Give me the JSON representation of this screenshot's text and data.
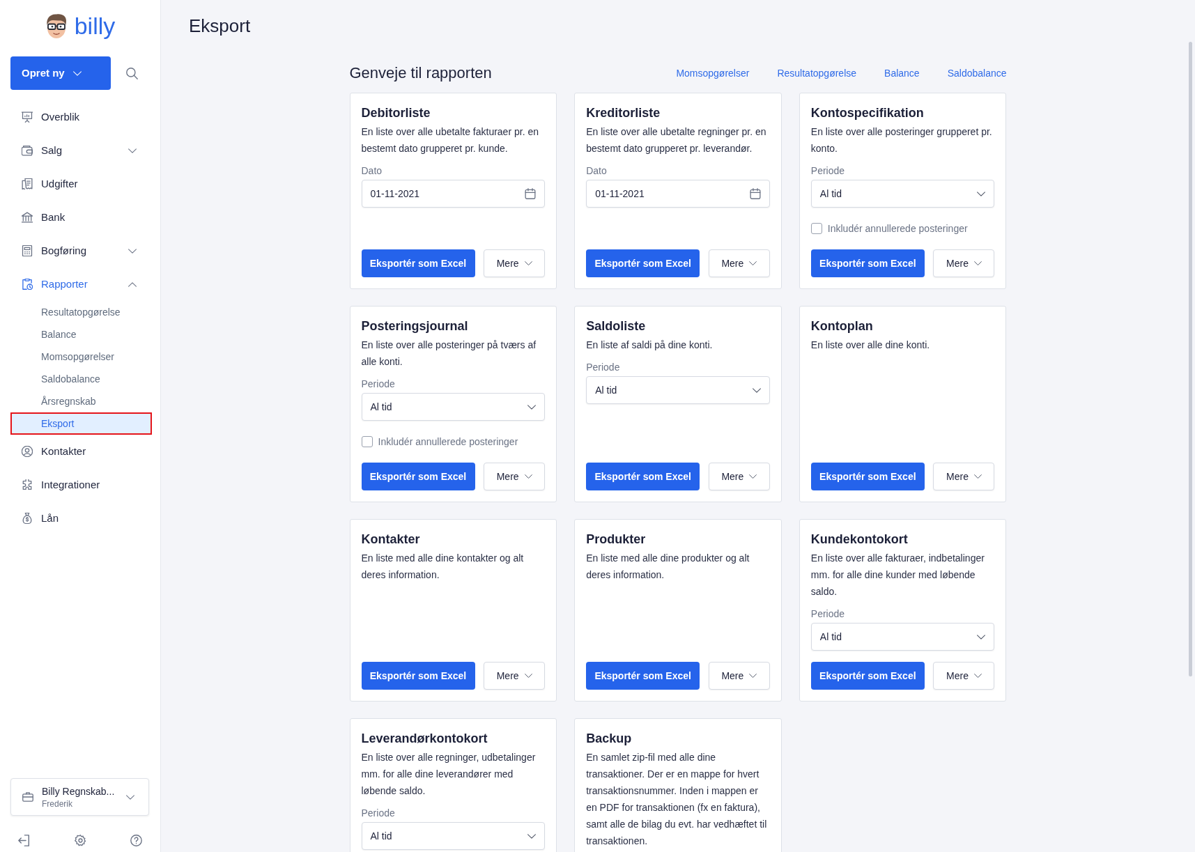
{
  "sidebar": {
    "logo": "billy",
    "create_button": "Opret ny",
    "nav": [
      {
        "label": "Overblik",
        "kind": "link",
        "selected": false
      },
      {
        "label": "Salg",
        "kind": "group",
        "selected": false,
        "expanded": false
      },
      {
        "label": "Udgifter",
        "kind": "link",
        "selected": false
      },
      {
        "label": "Bank",
        "kind": "link",
        "selected": false
      },
      {
        "label": "Bogføring",
        "kind": "group",
        "selected": false,
        "expanded": false
      },
      {
        "label": "Rapporter",
        "kind": "group",
        "selected": true,
        "expanded": true,
        "children": [
          {
            "label": "Resultatopgørelse",
            "selected": false,
            "highlighted": false
          },
          {
            "label": "Balance",
            "selected": false,
            "highlighted": false
          },
          {
            "label": "Momsopgørelser",
            "selected": false,
            "highlighted": false
          },
          {
            "label": "Saldobalance",
            "selected": false,
            "highlighted": false
          },
          {
            "label": "Årsregnskab",
            "selected": false,
            "highlighted": false
          },
          {
            "label": "Eksport",
            "selected": true,
            "highlighted": true
          }
        ]
      },
      {
        "label": "Kontakter",
        "kind": "link",
        "selected": false
      },
      {
        "label": "Integrationer",
        "kind": "link",
        "selected": false
      },
      {
        "label": "Lån",
        "kind": "link",
        "selected": false
      }
    ],
    "account": {
      "name": "Billy Regnskab...",
      "user": "Frederik"
    }
  },
  "page_title": "Eksport",
  "shortcuts": {
    "title": "Genveje til rapporten",
    "links": [
      "Momsopgørelser",
      "Resultatopgørelse",
      "Balance",
      "Saldobalance"
    ]
  },
  "cards": [
    {
      "title": "Debitorliste",
      "description": "En liste over alle ubetalte fakturaer pr. en bestemt dato grupperet pr. kunde.",
      "field": {
        "kind": "date",
        "label": "Dato",
        "value": "01-11-2021"
      },
      "buttons": {
        "export": "Eksportér som Excel",
        "more": "Mere"
      }
    },
    {
      "title": "Kreditorliste",
      "description": "En liste over alle ubetalte regninger pr. en bestemt dato grupperet pr. leverandør.",
      "field": {
        "kind": "date",
        "label": "Dato",
        "value": "01-11-2021"
      },
      "buttons": {
        "export": "Eksportér som Excel",
        "more": "Mere"
      }
    },
    {
      "title": "Kontospecifikation",
      "description": "En liste over alle posteringer grupperet pr. konto.",
      "field": {
        "kind": "select",
        "label": "Periode",
        "value": "Al tid"
      },
      "checkbox": {
        "label": "Inkludér annullerede posteringer",
        "checked": false
      },
      "buttons": {
        "export": "Eksportér som Excel",
        "more": "Mere"
      }
    },
    {
      "title": "Posteringsjournal",
      "description": "En liste over alle posteringer på tværs af alle konti.",
      "field": {
        "kind": "select",
        "label": "Periode",
        "value": "Al tid"
      },
      "checkbox": {
        "label": "Inkludér annullerede posteringer",
        "checked": false
      },
      "buttons": {
        "export": "Eksportér som Excel",
        "more": "Mere"
      }
    },
    {
      "title": "Saldoliste",
      "description": "En liste af saldi på dine konti.",
      "field": {
        "kind": "select",
        "label": "Periode",
        "value": "Al tid"
      },
      "buttons": {
        "export": "Eksportér som Excel",
        "more": "Mere"
      }
    },
    {
      "title": "Kontoplan",
      "description": "En liste over alle dine konti.",
      "buttons": {
        "export": "Eksportér som Excel",
        "more": "Mere"
      }
    },
    {
      "title": "Kontakter",
      "description": "En liste med alle dine kontakter og alt deres information.",
      "buttons": {
        "export": "Eksportér som Excel",
        "more": "Mere"
      }
    },
    {
      "title": "Produkter",
      "description": "En liste med alle dine produkter og alt deres information.",
      "buttons": {
        "export": "Eksportér som Excel",
        "more": "Mere"
      }
    },
    {
      "title": "Kundekontokort",
      "description": "En liste over alle fakturaer, indbetalinger mm. for alle dine kunder med løbende saldo.",
      "field": {
        "kind": "select",
        "label": "Periode",
        "value": "Al tid"
      },
      "buttons": {
        "export": "Eksportér som Excel",
        "more": "Mere"
      }
    },
    {
      "title": "Leverandørkontokort",
      "description": "En liste over alle regninger, udbetalinger mm. for alle dine leverandører med løbende saldo.",
      "field": {
        "kind": "select",
        "label": "Periode",
        "value": "Al tid"
      }
    },
    {
      "title": "Backup",
      "description": "En samlet zip-fil med alle dine transaktioner. Der er en mappe for hvert transaktionsnummer. Inden i mappen er en PDF for transaktionen (fx en faktura), samt alle de bilag du evt. har vedhæftet til transaktionen."
    }
  ]
}
